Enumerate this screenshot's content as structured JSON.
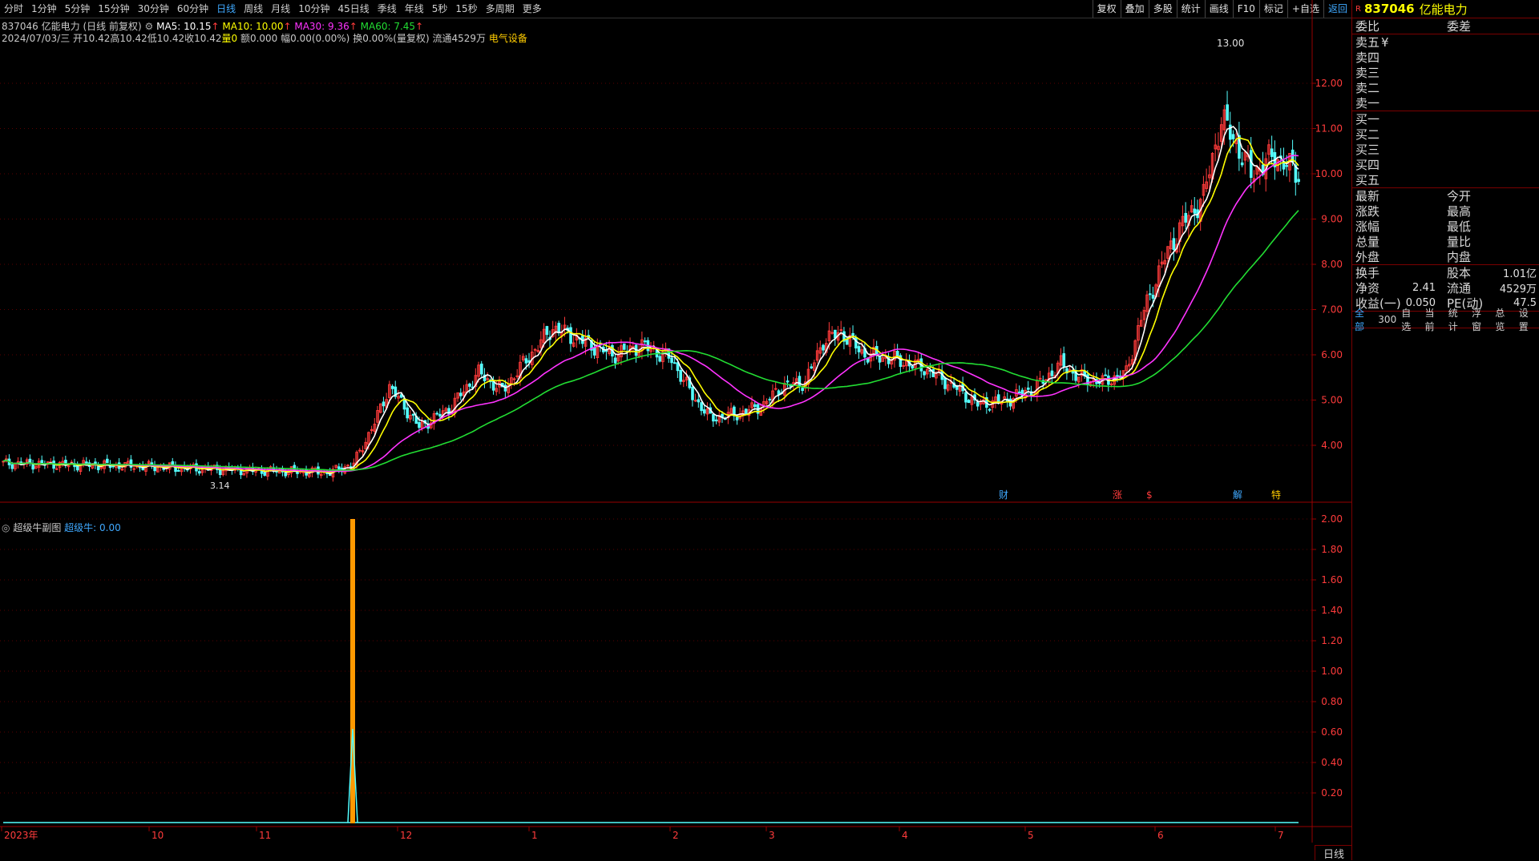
{
  "toolbar": {
    "periods": [
      "分时",
      "1分钟",
      "5分钟",
      "15分钟",
      "30分钟",
      "60分钟",
      "日线",
      "周线",
      "月线",
      "10分钟",
      "45日线",
      "季线",
      "年线",
      "5秒",
      "15秒",
      "多周期",
      "更多"
    ],
    "active_period": "日线",
    "right_buttons": [
      "复权",
      "叠加",
      "多股",
      "统计",
      "画线",
      "F10",
      "标记",
      "+自选",
      "返回"
    ]
  },
  "stock": {
    "code": "837046",
    "name": "亿能电力",
    "mode": "(日线 前复权)",
    "ma5": "MA5: 10.15",
    "ma10": "MA10: 10.00",
    "ma30": "MA30: 9.36",
    "ma60": "MA60: 7.45",
    "date": "2024/07/03/三",
    "open": "开10.42",
    "high": "高10.42",
    "low": "低10.42",
    "close": "收10.42",
    "vol": "量0",
    "amount": "额0.000",
    "change": "幅0.00(0.00%)",
    "turnover": "换0.00%(量复权)",
    "float": "流通4529万",
    "industry": "电气设备"
  },
  "colors": {
    "up": "#ff3b3b",
    "down": "#54ffff",
    "ma5": "#ffffff",
    "ma10": "#ffff00",
    "ma30": "#ff33ff",
    "ma60": "#22dd33",
    "axis": "#990000",
    "indicator": "#ff9900"
  },
  "main_axis": {
    "ticks": [
      "12.00",
      "11.00",
      "10.00",
      "9.00",
      "8.00",
      "7.00",
      "6.00",
      "5.00",
      "4.00"
    ],
    "high_label": "13.00",
    "low_label": "3.14",
    "markers": [
      "财",
      "涨",
      "$",
      "解",
      "特"
    ]
  },
  "sub_chart": {
    "title": "超级牛副图",
    "value_label": "超级牛: 0.00",
    "ticks": [
      "2.00",
      "1.80",
      "1.60",
      "1.40",
      "1.20",
      "1.00",
      "0.80",
      "0.60",
      "0.40",
      "0.20"
    ]
  },
  "x_axis": {
    "labels": [
      "2023年",
      "10",
      "11",
      "12",
      "1",
      "2",
      "3",
      "4",
      "5",
      "6",
      "7"
    ],
    "period_label": "日线"
  },
  "right_panel": {
    "r_badge": "R",
    "code": "837046",
    "name": "亿能电力",
    "weibi": "委比",
    "weicha": "委差",
    "sell": [
      "卖五",
      "卖四",
      "卖三",
      "卖二",
      "卖一"
    ],
    "currency": "¥",
    "buy": [
      "买一",
      "买二",
      "买三",
      "买四",
      "买五"
    ],
    "quote_left": [
      "最新",
      "涨跌",
      "涨幅",
      "总量",
      "外盘"
    ],
    "quote_right": [
      "今开",
      "最高",
      "最低",
      "量比",
      "内盘"
    ],
    "stats": [
      {
        "l1": "换手",
        "v1": "",
        "l2": "股本",
        "v2": "1.01亿"
      },
      {
        "l1": "净资",
        "v1": "2.41",
        "l2": "流通",
        "v2": "4529万"
      },
      {
        "l1": "收益(一)",
        "v1": "0.050",
        "l2": "PE(动)",
        "v2": "47.5"
      }
    ],
    "tabs": [
      "全部",
      "300",
      "自选",
      "当前",
      "统计",
      "浮窗",
      "总览",
      "设置"
    ]
  }
}
